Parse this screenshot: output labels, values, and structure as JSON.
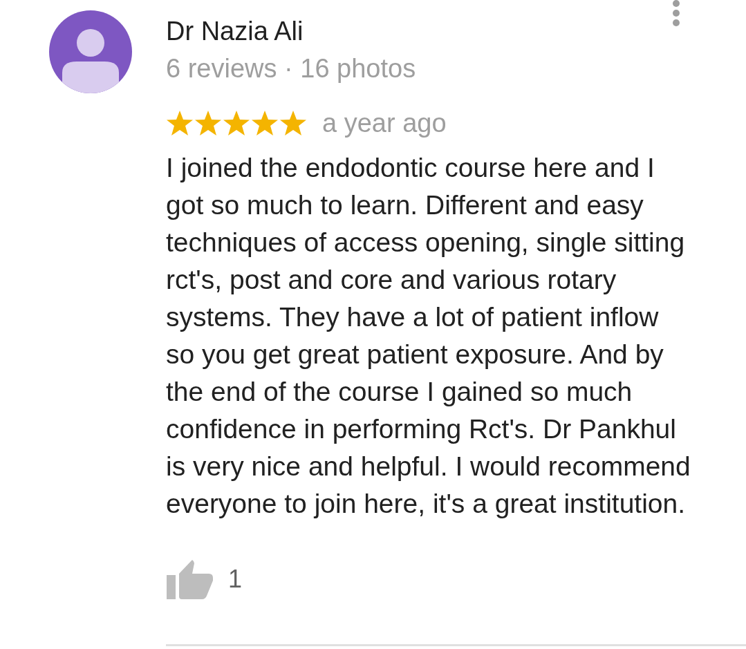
{
  "reviewer": {
    "name": "Dr Nazia Ali",
    "stats": "6 reviews · 16 photos"
  },
  "review": {
    "stars": 5,
    "time": "a year ago",
    "text": "I joined the endodontic course here and I got so much to learn. Different and easy techniques of access opening, single sitting rct's, post and core and various rotary systems. They have a lot of patient inflow so you get great patient exposure. And by the end of the course I gained so much confidence in performing Rct's. Dr Pankhul is very nice and helpful. I would recommend everyone to join here, it's a great institution."
  },
  "likes": {
    "count": "1"
  }
}
